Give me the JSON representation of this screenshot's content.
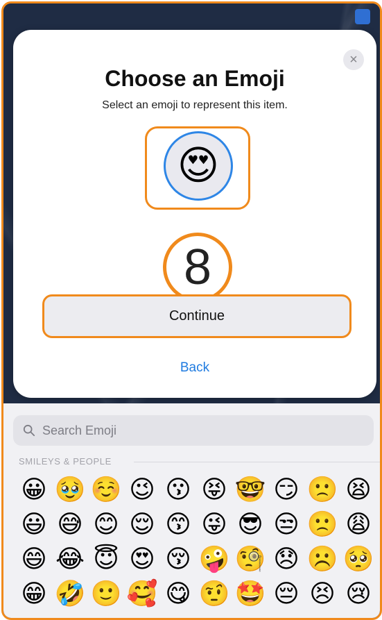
{
  "dialog": {
    "title": "Choose an Emoji",
    "subtitle": "Select an emoji to represent this item.",
    "selected_emoji": "😍",
    "close_glyph": "×",
    "step_number": "8",
    "continue_label": "Continue",
    "back_label": "Back"
  },
  "picker": {
    "search_placeholder": "Search Emoji",
    "section_label": "SMILEYS & PEOPLE",
    "emojis": [
      "😀",
      "🥹",
      "☺️",
      "😉",
      "😗",
      "😝",
      "🤓",
      "😏",
      "🙁",
      "😫",
      "😃",
      "😅",
      "😊",
      "😌",
      "😙",
      "😜",
      "😎",
      "😒",
      "🙁",
      "😩",
      "😄",
      "😂",
      "😇",
      "😍",
      "😚",
      "🤪",
      "🧐",
      "😞",
      "☹️",
      "🥺",
      "😁",
      "🤣",
      "🙂",
      "🥰",
      "😋",
      "🤨",
      "🤩",
      "😔",
      "😣",
      "😢"
    ]
  },
  "colors": {
    "highlight": "#f08a1c",
    "selection_ring": "#2e86e6",
    "link": "#1f7be0"
  }
}
